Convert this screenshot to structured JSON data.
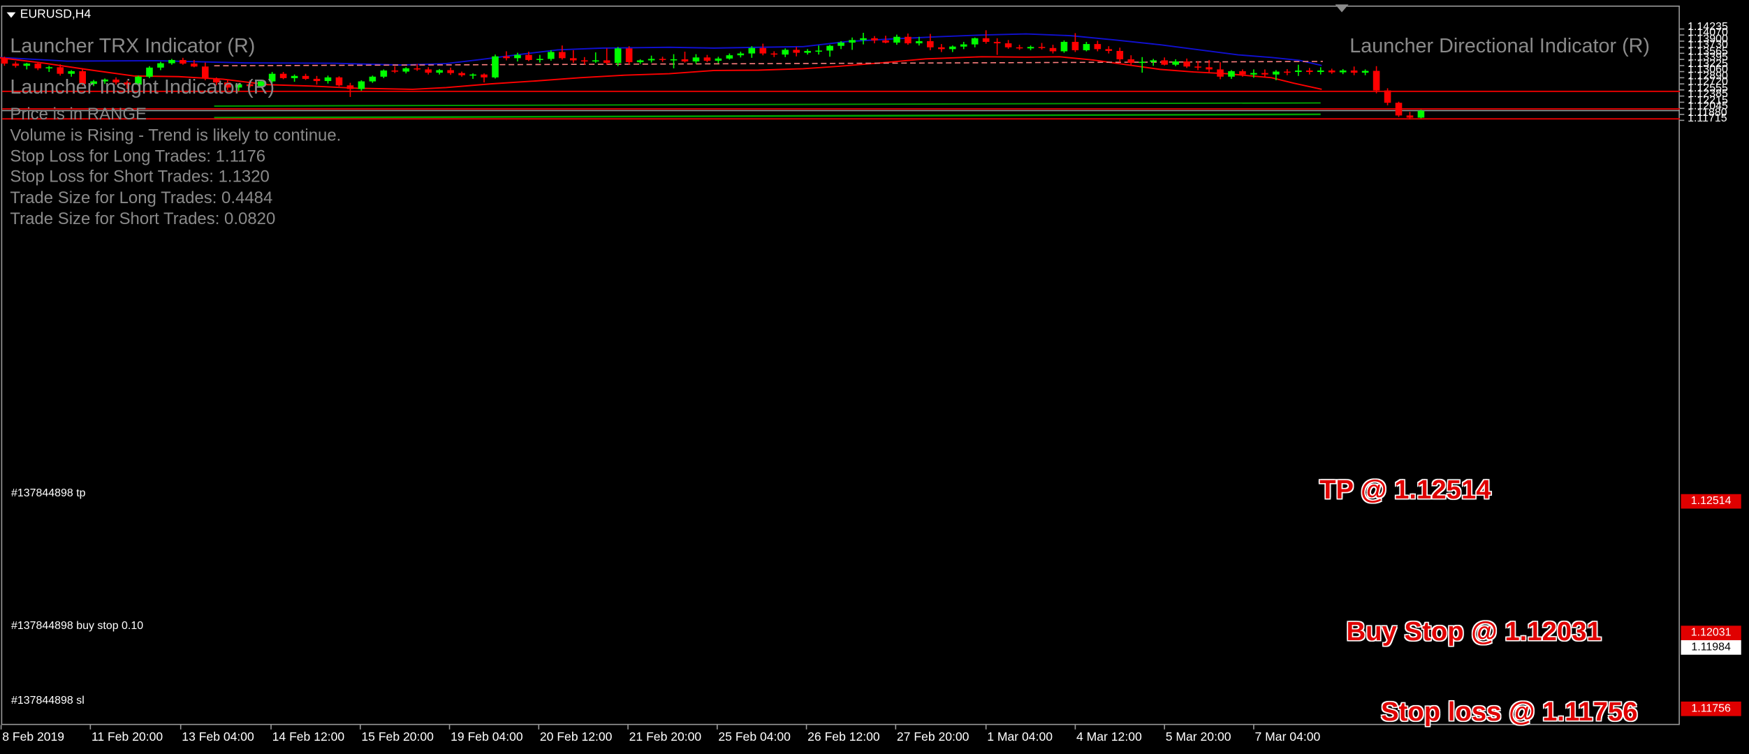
{
  "symbol_title": "EURUSD,H4",
  "indicators": {
    "trx": "Launcher TRX Indicator (R)",
    "directional": "Launcher Directional Indicator (R)",
    "insight": "Launcher Insight Indicator (R)"
  },
  "insight_lines": [
    "Price is in RANGE",
    "Volume is Rising - Trend is likely to continue.",
    "Stop Loss for Long Trades: 1.1176",
    "Stop Loss for Short Trades: 1.1320",
    "Trade Size for Long Trades: 0.4484",
    "Trade Size for Short Trades: 0.0820"
  ],
  "orders": {
    "tp_label": "#137844898 tp",
    "buy_stop_label": "#137844898 buy stop 0.10",
    "sl_label": "#137844898 sl"
  },
  "annotations": {
    "tp": "TP @ 1.12514",
    "buy_stop": "Buy Stop @ 1.12031",
    "stop_loss": "Stop loss @ 1.11756"
  },
  "price_labels": {
    "tp": "1.12514",
    "buy_stop": "1.12031",
    "current": "1.11984",
    "stop_loss": "1.11756"
  },
  "colors": {
    "background": "#000000",
    "bull_candle": "#00ff00",
    "bear_candle": "#ff0000",
    "upper_band": "#1010d0",
    "lower_band": "#ff0000",
    "order_line": "#e00000",
    "trend_line": "#00a000",
    "dashed_level": "#ff8080"
  },
  "chart_data": {
    "type": "candlestick",
    "symbol": "EURUSD",
    "timeframe": "H4",
    "ylim": [
      1.1171,
      1.1426
    ],
    "y_ticks": [
      "1.14235",
      "1.14070",
      "1.13900",
      "1.13730",
      "1.13565",
      "1.13395",
      "1.13225",
      "1.13060",
      "1.12890",
      "1.12720",
      "1.12555",
      "1.12385",
      "1.12215",
      "1.12045",
      "1.11880",
      "1.11715"
    ],
    "x_ticks": [
      "8 Feb 2019",
      "11 Feb 20:00",
      "13 Feb 04:00",
      "14 Feb 12:00",
      "15 Feb 20:00",
      "19 Feb 04:00",
      "20 Feb 12:00",
      "21 Feb 20:00",
      "25 Feb 04:00",
      "26 Feb 12:00",
      "27 Feb 20:00",
      "1 Mar 04:00",
      "4 Mar 12:00",
      "5 Mar 20:00",
      "7 Mar 04:00"
    ],
    "levels": {
      "take_profit": 1.12514,
      "buy_stop": 1.12031,
      "stop_loss": 1.11756,
      "current_price": 1.11984,
      "dashed_resistance_start": 1.1322,
      "dashed_resistance_end": 1.1334
    },
    "candles": [
      [
        1.1342,
        1.1347,
        1.1322,
        1.1328
      ],
      [
        1.1328,
        1.1334,
        1.1317,
        1.1322
      ],
      [
        1.1322,
        1.133,
        1.1312,
        1.1328
      ],
      [
        1.1328,
        1.1333,
        1.131,
        1.1315
      ],
      [
        1.1315,
        1.1322,
        1.1305,
        1.1318
      ],
      [
        1.1318,
        1.1326,
        1.1295,
        1.13
      ],
      [
        1.13,
        1.131,
        1.1292,
        1.1307
      ],
      [
        1.1307,
        1.1312,
        1.1268,
        1.1272
      ],
      [
        1.1272,
        1.1283,
        1.1266,
        1.1279
      ],
      [
        1.1279,
        1.1287,
        1.1272,
        1.1284
      ],
      [
        1.1284,
        1.129,
        1.127,
        1.1276
      ],
      [
        1.1276,
        1.1281,
        1.1258,
        1.127
      ],
      [
        1.127,
        1.1295,
        1.1268,
        1.1292
      ],
      [
        1.1292,
        1.1321,
        1.1288,
        1.1317
      ],
      [
        1.1317,
        1.1333,
        1.131,
        1.1329
      ],
      [
        1.1329,
        1.1341,
        1.1325,
        1.1338
      ],
      [
        1.1338,
        1.1344,
        1.1325,
        1.1328
      ],
      [
        1.1328,
        1.1338,
        1.1318,
        1.132
      ],
      [
        1.132,
        1.1331,
        1.1282,
        1.1287
      ],
      [
        1.1287,
        1.129,
        1.1268,
        1.1276
      ],
      [
        1.1276,
        1.1284,
        1.1255,
        1.1262
      ],
      [
        1.1262,
        1.1274,
        1.1252,
        1.1271
      ],
      [
        1.1271,
        1.1282,
        1.1262,
        1.1266
      ],
      [
        1.1266,
        1.1282,
        1.1264,
        1.1279
      ],
      [
        1.1279,
        1.1305,
        1.1275,
        1.13
      ],
      [
        1.13,
        1.1305,
        1.1285,
        1.1288
      ],
      [
        1.1288,
        1.1298,
        1.1278,
        1.1294
      ],
      [
        1.1294,
        1.13,
        1.1283,
        1.1286
      ],
      [
        1.1286,
        1.1294,
        1.127,
        1.128
      ],
      [
        1.128,
        1.1295,
        1.1273,
        1.129
      ],
      [
        1.129,
        1.1293,
        1.1265,
        1.1268
      ],
      [
        1.1268,
        1.1275,
        1.1236,
        1.1258
      ],
      [
        1.1258,
        1.1282,
        1.1253,
        1.1279
      ],
      [
        1.1279,
        1.1295,
        1.1275,
        1.1292
      ],
      [
        1.1292,
        1.1312,
        1.1288,
        1.1309
      ],
      [
        1.1309,
        1.1321,
        1.1302,
        1.1306
      ],
      [
        1.1306,
        1.1318,
        1.1301,
        1.1315
      ],
      [
        1.1315,
        1.1327,
        1.1308,
        1.1312
      ],
      [
        1.1312,
        1.1318,
        1.1298,
        1.1303
      ],
      [
        1.1303,
        1.1313,
        1.1298,
        1.131
      ],
      [
        1.131,
        1.1317,
        1.1297,
        1.1302
      ],
      [
        1.1302,
        1.1306,
        1.1292,
        1.1296
      ],
      [
        1.1296,
        1.1301,
        1.1286,
        1.1298
      ],
      [
        1.1298,
        1.1301,
        1.1276,
        1.129
      ],
      [
        1.129,
        1.1353,
        1.1287,
        1.1348
      ],
      [
        1.1348,
        1.1362,
        1.1337,
        1.1343
      ],
      [
        1.1343,
        1.1358,
        1.1334,
        1.1352
      ],
      [
        1.1352,
        1.1361,
        1.1335,
        1.1338
      ],
      [
        1.1338,
        1.1352,
        1.1331,
        1.1341
      ],
      [
        1.1341,
        1.1365,
        1.1336,
        1.136
      ],
      [
        1.136,
        1.1378,
        1.1339,
        1.1343
      ],
      [
        1.1343,
        1.1365,
        1.133,
        1.1337
      ],
      [
        1.1337,
        1.1346,
        1.1325,
        1.1335
      ],
      [
        1.1335,
        1.1359,
        1.133,
        1.1337
      ],
      [
        1.1337,
        1.137,
        1.1325,
        1.133
      ],
      [
        1.133,
        1.1374,
        1.1321,
        1.137
      ],
      [
        1.137,
        1.1376,
        1.1325,
        1.1332
      ],
      [
        1.1332,
        1.134,
        1.1327,
        1.1337
      ],
      [
        1.1337,
        1.135,
        1.1331,
        1.1341
      ],
      [
        1.1341,
        1.1347,
        1.1333,
        1.1338
      ],
      [
        1.1338,
        1.1354,
        1.1315,
        1.134
      ],
      [
        1.134,
        1.1361,
        1.1331,
        1.1334
      ],
      [
        1.1334,
        1.1354,
        1.1328,
        1.1345
      ],
      [
        1.1345,
        1.1352,
        1.1332,
        1.1336
      ],
      [
        1.1336,
        1.1347,
        1.1329,
        1.1342
      ],
      [
        1.1342,
        1.1356,
        1.1339,
        1.1351
      ],
      [
        1.1351,
        1.1361,
        1.1345,
        1.1356
      ],
      [
        1.1356,
        1.1376,
        1.1344,
        1.1371
      ],
      [
        1.1371,
        1.1383,
        1.1351,
        1.1356
      ],
      [
        1.1356,
        1.1362,
        1.1346,
        1.1353
      ],
      [
        1.1353,
        1.137,
        1.1346,
        1.1366
      ],
      [
        1.1366,
        1.1374,
        1.1348,
        1.1358
      ],
      [
        1.1358,
        1.1368,
        1.1353,
        1.1363
      ],
      [
        1.1363,
        1.1378,
        1.1353,
        1.1364
      ],
      [
        1.1364,
        1.138,
        1.1347,
        1.1377
      ],
      [
        1.1377,
        1.139,
        1.1368,
        1.1386
      ],
      [
        1.1386,
        1.14,
        1.1366,
        1.1393
      ],
      [
        1.1393,
        1.1413,
        1.1381,
        1.1398
      ],
      [
        1.1398,
        1.1404,
        1.1384,
        1.1392
      ],
      [
        1.1392,
        1.1405,
        1.1384,
        1.1386
      ],
      [
        1.1386,
        1.1408,
        1.138,
        1.1402
      ],
      [
        1.1402,
        1.1411,
        1.138,
        1.1384
      ],
      [
        1.1384,
        1.1402,
        1.1378,
        1.139
      ],
      [
        1.139,
        1.141,
        1.1365,
        1.1373
      ],
      [
        1.1373,
        1.1382,
        1.136,
        1.1368
      ],
      [
        1.1368,
        1.1378,
        1.136,
        1.1375
      ],
      [
        1.1375,
        1.1388,
        1.1368,
        1.1381
      ],
      [
        1.1381,
        1.14,
        1.1373,
        1.1398
      ],
      [
        1.1398,
        1.142,
        1.1383,
        1.1388
      ],
      [
        1.1388,
        1.1398,
        1.1352,
        1.1384
      ],
      [
        1.1384,
        1.1393,
        1.1369,
        1.1373
      ],
      [
        1.1373,
        1.138,
        1.1366,
        1.137
      ],
      [
        1.137,
        1.1378,
        1.1365,
        1.1374
      ],
      [
        1.1374,
        1.1385,
        1.1367,
        1.1371
      ],
      [
        1.1371,
        1.138,
        1.1356,
        1.1362
      ],
      [
        1.1362,
        1.1392,
        1.1358,
        1.1388
      ],
      [
        1.1388,
        1.1412,
        1.136,
        1.1365
      ],
      [
        1.1365,
        1.1388,
        1.1362,
        1.1382
      ],
      [
        1.1382,
        1.1391,
        1.1362,
        1.1368
      ],
      [
        1.1368,
        1.1376,
        1.1356,
        1.1363
      ],
      [
        1.1363,
        1.1372,
        1.1332,
        1.134
      ],
      [
        1.134,
        1.1351,
        1.1322,
        1.133
      ],
      [
        1.133,
        1.1346,
        1.1303,
        1.1333
      ],
      [
        1.1333,
        1.1341,
        1.1322,
        1.1337
      ],
      [
        1.1337,
        1.1345,
        1.1323,
        1.1325
      ],
      [
        1.1325,
        1.134,
        1.1321,
        1.1334
      ],
      [
        1.1334,
        1.1342,
        1.1316,
        1.132
      ],
      [
        1.132,
        1.1335,
        1.131,
        1.1318
      ],
      [
        1.1318,
        1.1338,
        1.1304,
        1.1312
      ],
      [
        1.1312,
        1.1332,
        1.1285,
        1.1292
      ],
      [
        1.1292,
        1.131,
        1.1286,
        1.1307
      ],
      [
        1.1307,
        1.1312,
        1.1292,
        1.1298
      ],
      [
        1.1298,
        1.1312,
        1.1289,
        1.1302
      ],
      [
        1.1302,
        1.1312,
        1.129,
        1.1298
      ],
      [
        1.1298,
        1.131,
        1.1282,
        1.1306
      ],
      [
        1.1306,
        1.1313,
        1.1296,
        1.1305
      ],
      [
        1.1305,
        1.1325,
        1.1294,
        1.1309
      ],
      [
        1.1309,
        1.1316,
        1.1298,
        1.1305
      ],
      [
        1.1305,
        1.1318,
        1.1298,
        1.1309
      ],
      [
        1.1309,
        1.1314,
        1.13,
        1.1304
      ],
      [
        1.1304,
        1.1313,
        1.1299,
        1.1309
      ],
      [
        1.1309,
        1.132,
        1.1296,
        1.1303
      ],
      [
        1.1303,
        1.1312,
        1.1296,
        1.1308
      ],
      [
        1.1308,
        1.1321,
        1.1246,
        1.1254
      ],
      [
        1.1254,
        1.126,
        1.1213,
        1.122
      ],
      [
        1.122,
        1.1223,
        1.1181,
        1.1185
      ],
      [
        1.1185,
        1.1195,
        1.1174,
        1.1179
      ],
      [
        1.1179,
        1.1201,
        1.1177,
        1.1198
      ]
    ],
    "upper_band": [
      [
        0,
        1.1345
      ],
      [
        60,
        1.1335
      ],
      [
        140,
        1.1336
      ],
      [
        220,
        1.133
      ],
      [
        300,
        1.1329
      ],
      [
        360,
        1.1324
      ],
      [
        400,
        1.1328
      ],
      [
        430,
        1.1339
      ],
      [
        470,
        1.1355
      ],
      [
        500,
        1.1366
      ],
      [
        540,
        1.1371
      ],
      [
        600,
        1.1373
      ],
      [
        640,
        1.1371
      ],
      [
        680,
        1.1373
      ],
      [
        720,
        1.1375
      ],
      [
        760,
        1.1389
      ],
      [
        800,
        1.1396
      ],
      [
        840,
        1.1402
      ],
      [
        880,
        1.1407
      ],
      [
        920,
        1.141
      ],
      [
        960,
        1.1405
      ],
      [
        1000,
        1.1393
      ],
      [
        1040,
        1.138
      ],
      [
        1070,
        1.1368
      ],
      [
        1110,
        1.1352
      ],
      [
        1140,
        1.1345
      ],
      [
        1165,
        1.1337
      ],
      [
        1185,
        1.1323
      ]
    ],
    "lower_band": [
      [
        0,
        1.1344
      ],
      [
        40,
        1.1329
      ],
      [
        80,
        1.1311
      ],
      [
        120,
        1.1294
      ],
      [
        160,
        1.1292
      ],
      [
        200,
        1.1285
      ],
      [
        240,
        1.127
      ],
      [
        280,
        1.1266
      ],
      [
        320,
        1.126
      ],
      [
        370,
        1.1257
      ],
      [
        400,
        1.1262
      ],
      [
        440,
        1.1272
      ],
      [
        480,
        1.128
      ],
      [
        520,
        1.1289
      ],
      [
        560,
        1.1296
      ],
      [
        600,
        1.13
      ],
      [
        640,
        1.1309
      ],
      [
        680,
        1.131
      ],
      [
        720,
        1.1314
      ],
      [
        750,
        1.132
      ],
      [
        790,
        1.133
      ],
      [
        830,
        1.1341
      ],
      [
        880,
        1.1347
      ],
      [
        920,
        1.1346
      ],
      [
        950,
        1.1347
      ],
      [
        980,
        1.1338
      ],
      [
        1010,
        1.1325
      ],
      [
        1040,
        1.1312
      ],
      [
        1070,
        1.1305
      ],
      [
        1100,
        1.13
      ],
      [
        1140,
        1.1289
      ],
      [
        1160,
        1.1274
      ],
      [
        1185,
        1.1257
      ]
    ],
    "trend_lines": [
      {
        "from": [
          192,
          1.12108
        ],
        "to": [
          1184,
          1.12196
        ]
      },
      {
        "from": [
          192,
          1.11786
        ],
        "to": [
          1184,
          1.11881
        ]
      }
    ]
  }
}
